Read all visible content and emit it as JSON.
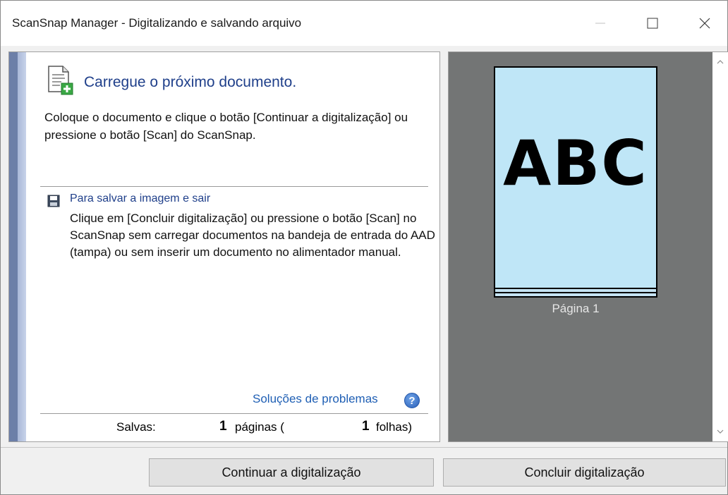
{
  "window": {
    "title": "ScanSnap Manager - Digitalizando e salvando arquivo",
    "icons": [
      "minimize-icon",
      "maximize-icon",
      "close-icon"
    ]
  },
  "left": {
    "heading": "Carregue o próximo documento.",
    "intro": "Coloque o documento e clique o botão [Continuar a digitalização] ou pressione o botão [Scan] do ScanSnap.",
    "save_title": "Para salvar a imagem e sair",
    "save_desc": "Clique em [Concluir digitalização] ou pressione o botão [Scan] no ScanSnap sem carregar documentos na bandeja de entrada do AAD (tampa) ou sem inserir um documento no alimentador manual.",
    "troubleshoot": "Soluções de problemas",
    "help_symbol": "?",
    "status": {
      "label": "Salvas:",
      "pages_value": "1",
      "pages_label": "páginas (",
      "sheets_value": "1",
      "sheets_label": "folhas)"
    }
  },
  "preview": {
    "page_text": "ABC",
    "caption": "Página 1"
  },
  "buttons": {
    "continue": "Continuar a digitalização",
    "finish": "Concluir digitalização"
  },
  "colors": {
    "heading": "#1f3f8a",
    "link": "#1f5fb4",
    "preview_bg": "#737575",
    "page_fill": "#bfe6f7"
  }
}
